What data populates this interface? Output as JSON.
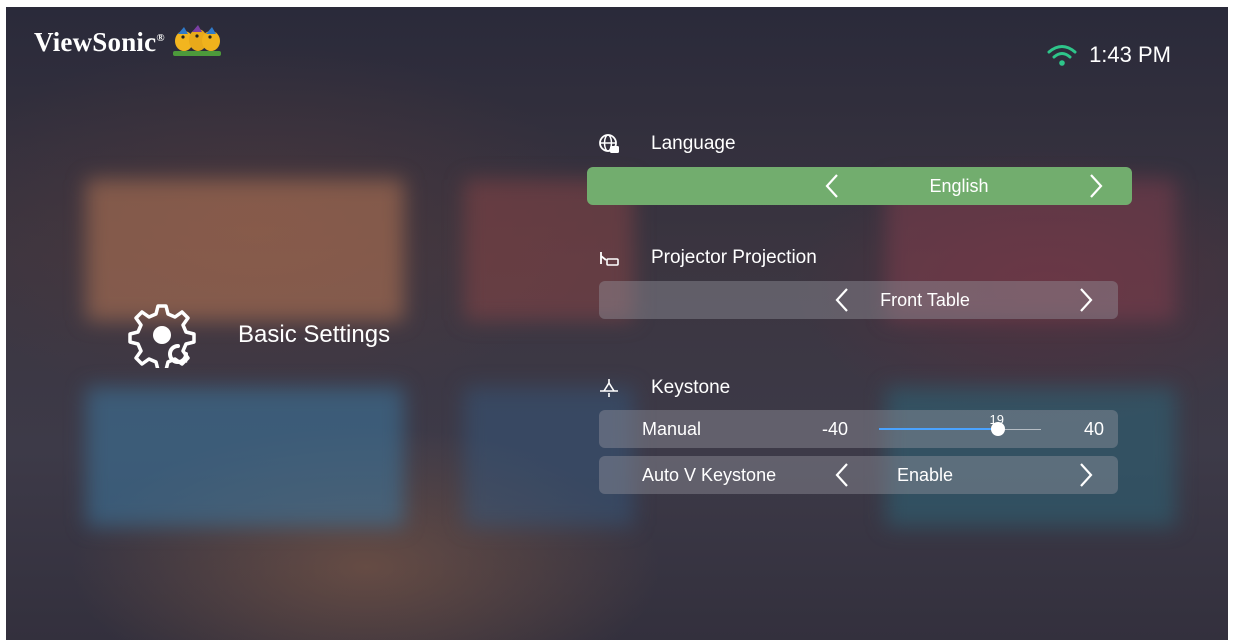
{
  "brand": {
    "logo_text": "ViewSonic",
    "logo_mark": "®"
  },
  "status": {
    "time": "1:43 PM",
    "wifi_icon": "wifi-icon"
  },
  "page": {
    "title": "Basic Settings",
    "icon": "gear-icon"
  },
  "language": {
    "label": "Language",
    "value": "English",
    "icon": "globe-icon"
  },
  "projection": {
    "label": "Projector Projection",
    "value": "Front Table",
    "icon": "projector-icon"
  },
  "keystone": {
    "label": "Keystone",
    "icon": "keystone-icon",
    "manual": {
      "label": "Manual",
      "min": "-40",
      "max": "40",
      "value": "19",
      "value_num": 19,
      "min_num": -40,
      "max_num": 40
    },
    "auto_v": {
      "label": "Auto V Keystone",
      "value": "Enable"
    }
  },
  "colors": {
    "selected_green": "#72ad6e",
    "slider_accent": "#4aa3ff"
  }
}
